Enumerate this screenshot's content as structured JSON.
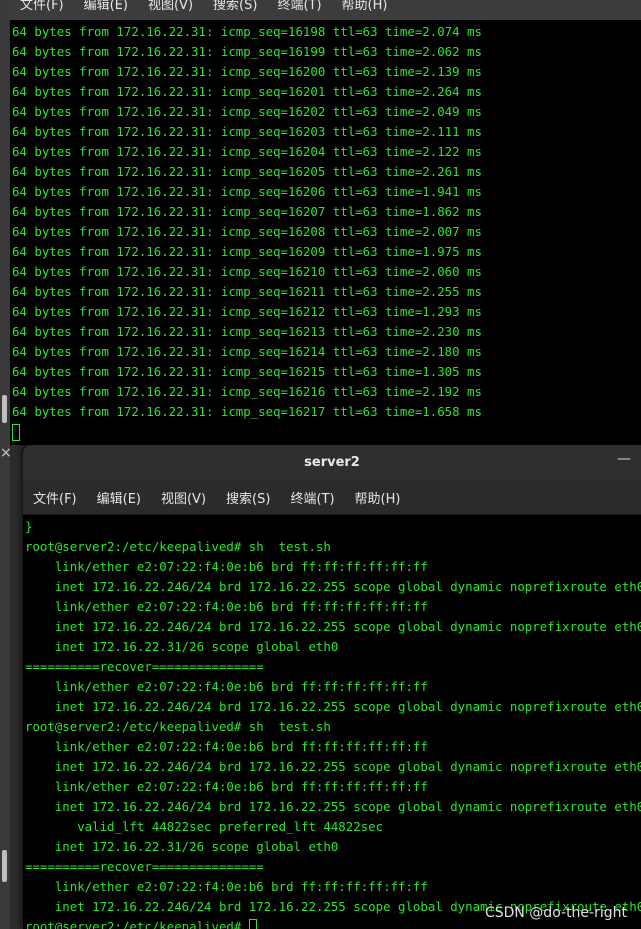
{
  "back_window": {
    "menu": [
      "文件(F)",
      "编辑(E)",
      "视图(V)",
      "搜索(S)",
      "终端(T)",
      "帮助(H)"
    ],
    "lines": [
      "64 bytes from 172.16.22.31: icmp_seq=16198 ttl=63 time=2.074 ms",
      "64 bytes from 172.16.22.31: icmp_seq=16199 ttl=63 time=2.062 ms",
      "64 bytes from 172.16.22.31: icmp_seq=16200 ttl=63 time=2.139 ms",
      "64 bytes from 172.16.22.31: icmp_seq=16201 ttl=63 time=2.264 ms",
      "64 bytes from 172.16.22.31: icmp_seq=16202 ttl=63 time=2.049 ms",
      "64 bytes from 172.16.22.31: icmp_seq=16203 ttl=63 time=2.111 ms",
      "64 bytes from 172.16.22.31: icmp_seq=16204 ttl=63 time=2.122 ms",
      "64 bytes from 172.16.22.31: icmp_seq=16205 ttl=63 time=2.261 ms",
      "64 bytes from 172.16.22.31: icmp_seq=16206 ttl=63 time=1.941 ms",
      "64 bytes from 172.16.22.31: icmp_seq=16207 ttl=63 time=1.862 ms",
      "64 bytes from 172.16.22.31: icmp_seq=16208 ttl=63 time=2.007 ms",
      "64 bytes from 172.16.22.31: icmp_seq=16209 ttl=63 time=1.975 ms",
      "64 bytes from 172.16.22.31: icmp_seq=16210 ttl=63 time=2.060 ms",
      "64 bytes from 172.16.22.31: icmp_seq=16211 ttl=63 time=2.255 ms",
      "64 bytes from 172.16.22.31: icmp_seq=16212 ttl=63 time=1.293 ms",
      "64 bytes from 172.16.22.31: icmp_seq=16213 ttl=63 time=2.230 ms",
      "64 bytes from 172.16.22.31: icmp_seq=16214 ttl=63 time=2.180 ms",
      "64 bytes from 172.16.22.31: icmp_seq=16215 ttl=63 time=1.305 ms",
      "64 bytes from 172.16.22.31: icmp_seq=16216 ttl=63 time=2.192 ms",
      "64 bytes from 172.16.22.31: icmp_seq=16217 ttl=63 time=1.658 ms"
    ]
  },
  "gap_close_icon": "×",
  "front_window": {
    "title": "server2",
    "minimize_icon": "—",
    "menu": [
      "文件(F)",
      "编辑(E)",
      "视图(V)",
      "搜索(S)",
      "终端(T)",
      "帮助(H)"
    ],
    "lines": [
      "}",
      "root@server2:/etc/keepalived# sh  test.sh",
      "    link/ether e2:07:22:f4:0e:b6 brd ff:ff:ff:ff:ff:ff",
      "    inet 172.16.22.246/24 brd 172.16.22.255 scope global dynamic noprefixroute eth0",
      "    link/ether e2:07:22:f4:0e:b6 brd ff:ff:ff:ff:ff:ff",
      "    inet 172.16.22.246/24 brd 172.16.22.255 scope global dynamic noprefixroute eth0",
      "    inet 172.16.22.31/26 scope global eth0",
      "==========recover===============",
      "    link/ether e2:07:22:f4:0e:b6 brd ff:ff:ff:ff:ff:ff",
      "    inet 172.16.22.246/24 brd 172.16.22.255 scope global dynamic noprefixroute eth0",
      "root@server2:/etc/keepalived# sh  test.sh",
      "    link/ether e2:07:22:f4:0e:b6 brd ff:ff:ff:ff:ff:ff",
      "    inet 172.16.22.246/24 brd 172.16.22.255 scope global dynamic noprefixroute eth0",
      "    link/ether e2:07:22:f4:0e:b6 brd ff:ff:ff:ff:ff:ff",
      "    inet 172.16.22.246/24 brd 172.16.22.255 scope global dynamic noprefixroute eth0",
      "       valid_lft 44822sec preferred_lft 44822sec",
      "    inet 172.16.22.31/26 scope global eth0",
      "==========recover===============",
      "    link/ether e2:07:22:f4:0e:b6 brd ff:ff:ff:ff:ff:ff",
      "    inet 172.16.22.246/24 brd 172.16.22.255 scope global dynamic noprefixroute eth0"
    ],
    "prompt": "root@server2:/etc/keepalived# "
  },
  "watermark": "CSDN @do-the-right",
  "colors": {
    "terminal_text": "#2ee42e",
    "terminal_bg": "#000000"
  }
}
